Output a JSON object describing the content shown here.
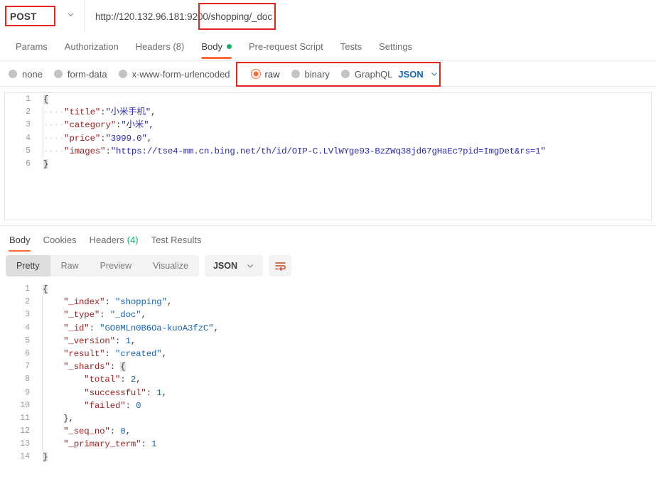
{
  "request_bar": {
    "method": "POST",
    "method_caret_icon": "chevron-down-icon",
    "url": "http://120.132.96.181:9200/shopping/_doc",
    "url_placeholder": "Enter request URL"
  },
  "request_tabs": [
    {
      "label": "Params",
      "active": false
    },
    {
      "label": "Authorization",
      "active": false
    },
    {
      "label": "Headers (8)",
      "active": false
    },
    {
      "label": "Body",
      "active": true,
      "dot": true
    },
    {
      "label": "Pre-request Script",
      "active": false
    },
    {
      "label": "Tests",
      "active": false
    },
    {
      "label": "Settings",
      "active": false
    }
  ],
  "body_types": [
    {
      "label": "none",
      "selected": false
    },
    {
      "label": "form-data",
      "selected": false
    },
    {
      "label": "x-www-form-urlencoded",
      "selected": false
    },
    {
      "label": "raw",
      "selected": true
    },
    {
      "label": "binary",
      "selected": false
    },
    {
      "label": "GraphQL",
      "selected": false
    }
  ],
  "body_format": {
    "value": "JSON",
    "caret_icon": "chevron-down-icon"
  },
  "request_body": {
    "lines": [
      {
        "n": "1",
        "indent": false,
        "tokens": [
          {
            "t": "{",
            "c": "tk-brace"
          }
        ]
      },
      {
        "n": "2",
        "indent": true,
        "tokens": [
          {
            "t": "····",
            "c": "tk-dots"
          },
          {
            "t": "\"title\"",
            "c": "tk-key"
          },
          {
            "t": ":",
            "c": "tk-punc"
          },
          {
            "t": "\"小米手机\"",
            "c": "tk-key2"
          },
          {
            "t": ",",
            "c": "tk-punc"
          }
        ]
      },
      {
        "n": "3",
        "indent": true,
        "tokens": [
          {
            "t": "····",
            "c": "tk-dots"
          },
          {
            "t": "\"category\"",
            "c": "tk-key"
          },
          {
            "t": ":",
            "c": "tk-punc"
          },
          {
            "t": "\"小米\"",
            "c": "tk-key2"
          },
          {
            "t": ",",
            "c": "tk-punc"
          }
        ]
      },
      {
        "n": "4",
        "indent": true,
        "tokens": [
          {
            "t": "····",
            "c": "tk-dots"
          },
          {
            "t": "\"price\"",
            "c": "tk-key"
          },
          {
            "t": ":",
            "c": "tk-punc"
          },
          {
            "t": "\"3999.0\"",
            "c": "tk-key2"
          },
          {
            "t": ",",
            "c": "tk-punc"
          }
        ]
      },
      {
        "n": "5",
        "indent": true,
        "tokens": [
          {
            "t": "····",
            "c": "tk-dots"
          },
          {
            "t": "\"images\"",
            "c": "tk-key"
          },
          {
            "t": ":",
            "c": "tk-punc"
          },
          {
            "t": "\"https://tse4-mm.cn.bing.net/th/id/OIP-C.LVlWYge93-BzZWq38jd67gHaEc?pid=ImgDet&rs=1\"",
            "c": "tk-key2"
          }
        ]
      },
      {
        "n": "6",
        "indent": false,
        "tokens": [
          {
            "t": "}",
            "c": "tk-brace"
          }
        ]
      }
    ]
  },
  "response_tabs": [
    {
      "label": "Body",
      "active": true
    },
    {
      "label": "Cookies",
      "active": false
    },
    {
      "label": "Headers",
      "active": false,
      "count": "(4)"
    },
    {
      "label": "Test Results",
      "active": false
    }
  ],
  "response_toolbar": {
    "views": [
      {
        "label": "Pretty",
        "active": true
      },
      {
        "label": "Raw",
        "active": false
      },
      {
        "label": "Preview",
        "active": false
      },
      {
        "label": "Visualize",
        "active": false
      }
    ],
    "format": "JSON",
    "format_caret_icon": "chevron-down-icon",
    "wrap_icon": "word-wrap-icon"
  },
  "response_body": {
    "lines": [
      {
        "n": "1",
        "indent": false,
        "tokens": [
          {
            "t": "{",
            "c": "tk-brace"
          }
        ]
      },
      {
        "n": "2",
        "indent": true,
        "tokens": [
          {
            "t": "    \"_index\"",
            "c": "tk-key"
          },
          {
            "t": ": ",
            "c": "tk-punc"
          },
          {
            "t": "\"shopping\"",
            "c": "tk-str"
          },
          {
            "t": ",",
            "c": "tk-punc"
          }
        ]
      },
      {
        "n": "3",
        "indent": true,
        "tokens": [
          {
            "t": "    \"_type\"",
            "c": "tk-key"
          },
          {
            "t": ": ",
            "c": "tk-punc"
          },
          {
            "t": "\"_doc\"",
            "c": "tk-str"
          },
          {
            "t": ",",
            "c": "tk-punc"
          }
        ]
      },
      {
        "n": "4",
        "indent": true,
        "tokens": [
          {
            "t": "    \"_id\"",
            "c": "tk-key"
          },
          {
            "t": ": ",
            "c": "tk-punc"
          },
          {
            "t": "\"GO0MLn0B6Oa-kuoA3fzC\"",
            "c": "tk-str"
          },
          {
            "t": ",",
            "c": "tk-punc"
          }
        ]
      },
      {
        "n": "5",
        "indent": true,
        "tokens": [
          {
            "t": "    \"_version\"",
            "c": "tk-key"
          },
          {
            "t": ": ",
            "c": "tk-punc"
          },
          {
            "t": "1",
            "c": "tk-num"
          },
          {
            "t": ",",
            "c": "tk-punc"
          }
        ]
      },
      {
        "n": "6",
        "indent": true,
        "tokens": [
          {
            "t": "    \"result\"",
            "c": "tk-key"
          },
          {
            "t": ": ",
            "c": "tk-punc"
          },
          {
            "t": "\"created\"",
            "c": "tk-str"
          },
          {
            "t": ",",
            "c": "tk-punc"
          }
        ]
      },
      {
        "n": "7",
        "indent": true,
        "tokens": [
          {
            "t": "    \"_shards\"",
            "c": "tk-key"
          },
          {
            "t": ": ",
            "c": "tk-punc"
          },
          {
            "t": "{",
            "c": "tk-brace"
          }
        ]
      },
      {
        "n": "8",
        "indent": true,
        "tokens": [
          {
            "t": "        \"total\"",
            "c": "tk-key"
          },
          {
            "t": ": ",
            "c": "tk-punc"
          },
          {
            "t": "2",
            "c": "tk-num"
          },
          {
            "t": ",",
            "c": "tk-punc"
          }
        ]
      },
      {
        "n": "9",
        "indent": true,
        "tokens": [
          {
            "t": "        \"successful\"",
            "c": "tk-key"
          },
          {
            "t": ": ",
            "c": "tk-punc"
          },
          {
            "t": "1",
            "c": "tk-num"
          },
          {
            "t": ",",
            "c": "tk-punc"
          }
        ]
      },
      {
        "n": "10",
        "indent": true,
        "tokens": [
          {
            "t": "        \"failed\"",
            "c": "tk-key"
          },
          {
            "t": ": ",
            "c": "tk-punc"
          },
          {
            "t": "0",
            "c": "tk-num"
          }
        ]
      },
      {
        "n": "11",
        "indent": true,
        "tokens": [
          {
            "t": "    }",
            "c": "tk-punc"
          },
          {
            "t": ",",
            "c": "tk-punc"
          }
        ]
      },
      {
        "n": "12",
        "indent": true,
        "tokens": [
          {
            "t": "    \"_seq_no\"",
            "c": "tk-key"
          },
          {
            "t": ": ",
            "c": "tk-punc"
          },
          {
            "t": "0",
            "c": "tk-num"
          },
          {
            "t": ",",
            "c": "tk-punc"
          }
        ]
      },
      {
        "n": "13",
        "indent": true,
        "tokens": [
          {
            "t": "    \"_primary_term\"",
            "c": "tk-key"
          },
          {
            "t": ": ",
            "c": "tk-punc"
          },
          {
            "t": "1",
            "c": "tk-num"
          }
        ]
      },
      {
        "n": "14",
        "indent": false,
        "tokens": [
          {
            "t": "}",
            "c": "tk-brace"
          }
        ]
      }
    ]
  },
  "annotations": {
    "accent_red": "#e8241f",
    "accent_orange": "#ff6c37",
    "accent_green": "#17b26a"
  }
}
